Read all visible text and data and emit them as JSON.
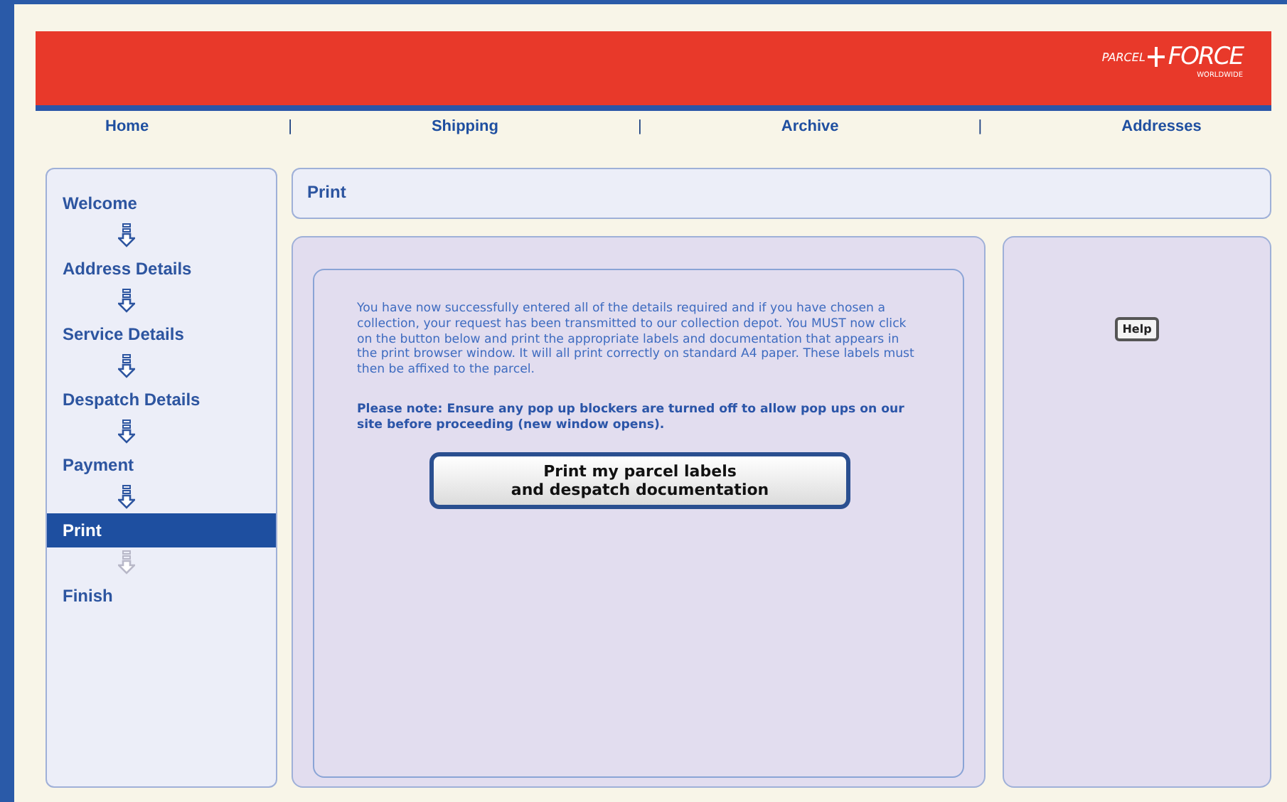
{
  "logo": {
    "left": "PARCEL",
    "right": "FORCE",
    "sub": "WORLDWIDE"
  },
  "nav": [
    {
      "label": "Home",
      "kind": "link"
    },
    {
      "label": "|",
      "kind": "separator"
    },
    {
      "label": "Shipping",
      "kind": "link"
    },
    {
      "label": "|",
      "kind": "separator"
    },
    {
      "label": "Archive",
      "kind": "link"
    },
    {
      "label": "|",
      "kind": "separator"
    },
    {
      "label": "Addresses",
      "kind": "link"
    }
  ],
  "steps": [
    {
      "label": "Welcome",
      "selected": false
    },
    {
      "label": "Address Details",
      "selected": false
    },
    {
      "label": "Service Details",
      "selected": false
    },
    {
      "label": "Despatch Details",
      "selected": false
    },
    {
      "label": "Payment",
      "selected": false
    },
    {
      "label": "Print",
      "selected": true
    },
    {
      "label": "Finish",
      "selected": false
    }
  ],
  "page_title": "Print",
  "message": "You have now successfully entered all of the details required and if you have chosen a collection, your request has been transmitted to our collection depot. You MUST now click on the button below and print the appropriate labels and documentation that appears in the print browser window. It will all print correctly on standard A4 paper. These labels must then be affixed to the parcel.",
  "note": "Please note: Ensure any pop up blockers are turned off to allow pop ups on our site before proceeding (new window opens).",
  "print_button": [
    "Print my parcel labels",
    "and despatch documentation"
  ],
  "help_button": "Help"
}
